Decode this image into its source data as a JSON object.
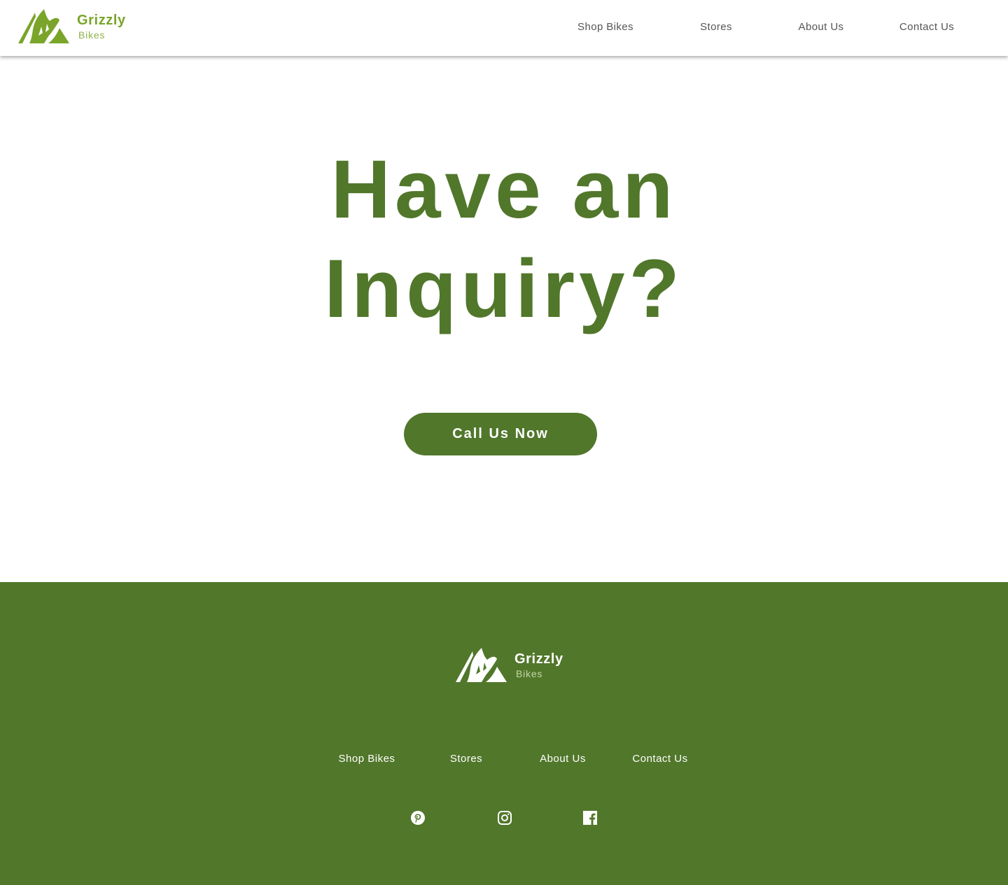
{
  "brand": {
    "name": "Grizzly",
    "tagline": "Bikes"
  },
  "nav": {
    "items": [
      {
        "label": "Shop Bikes"
      },
      {
        "label": "Stores"
      },
      {
        "label": "About Us"
      },
      {
        "label": "Contact Us"
      }
    ]
  },
  "hero": {
    "title_line1": "Have an",
    "title_line2": "Inquiry?",
    "cta_label": "Call Us Now"
  },
  "footer": {
    "brand": {
      "name": "Grizzly",
      "tagline": "Bikes"
    },
    "links": [
      {
        "label": "Shop Bikes"
      },
      {
        "label": "Stores"
      },
      {
        "label": "About Us"
      },
      {
        "label": "Contact Us"
      }
    ],
    "social": [
      {
        "icon": "pinterest-icon"
      },
      {
        "icon": "instagram-icon"
      },
      {
        "icon": "facebook-icon"
      }
    ]
  },
  "colors": {
    "brand_green": "#51772b",
    "logo_green": "#7aa52a",
    "nav_text": "#555555",
    "white": "#ffffff"
  }
}
